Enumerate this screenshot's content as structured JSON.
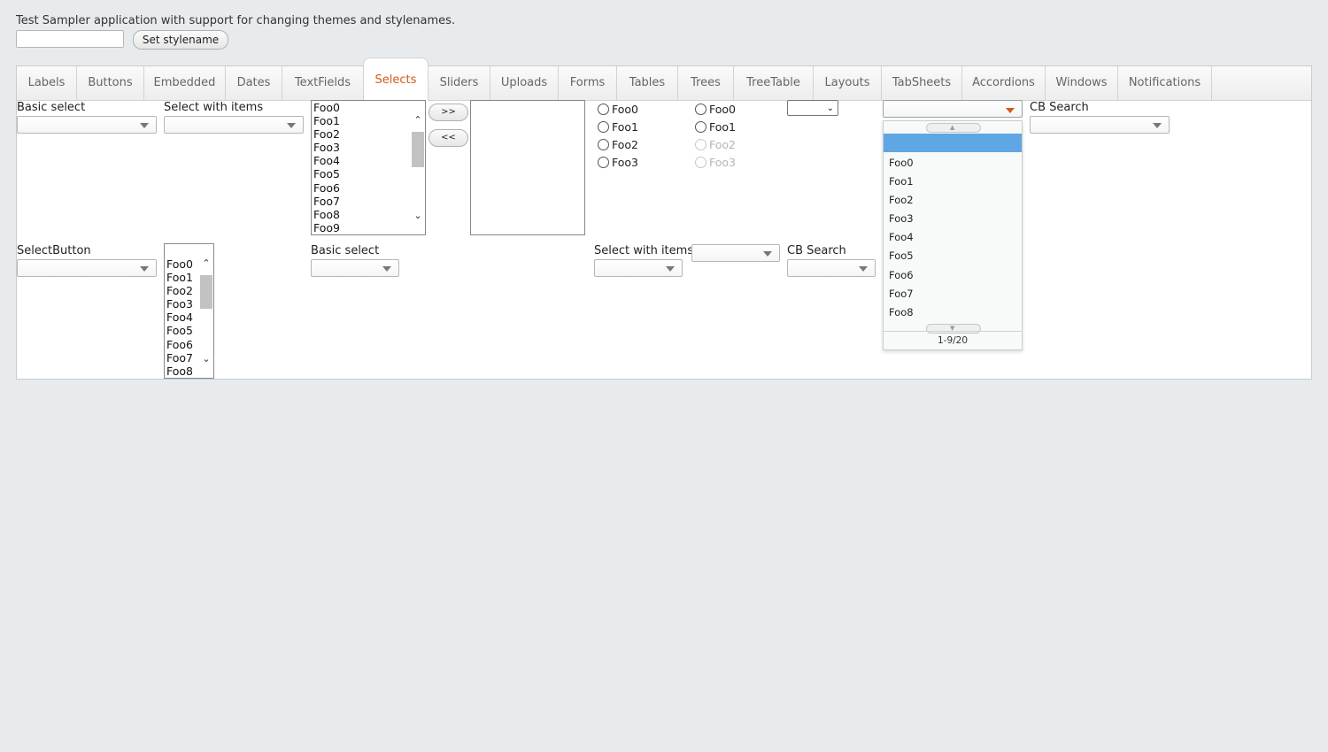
{
  "app": {
    "description": "Test Sampler application with support for changing themes and stylenames.",
    "stylename_input_value": "",
    "set_stylename_label": "Set stylename"
  },
  "tabs": [
    {
      "label": "Labels"
    },
    {
      "label": "Buttons"
    },
    {
      "label": "Embedded"
    },
    {
      "label": "Dates"
    },
    {
      "label": "TextFields"
    },
    {
      "label": "Selects",
      "selected": true
    },
    {
      "label": "Sliders"
    },
    {
      "label": "Uploads"
    },
    {
      "label": "Forms"
    },
    {
      "label": "Tables"
    },
    {
      "label": "Trees"
    },
    {
      "label": "TreeTable"
    },
    {
      "label": "Layouts"
    },
    {
      "label": "TabSheets"
    },
    {
      "label": "Accordions"
    },
    {
      "label": "Windows"
    },
    {
      "label": "Notifications"
    }
  ],
  "row1": {
    "basic_select_caption": "Basic select",
    "select_items_caption": "Select with items",
    "listbox_options": [
      "Foo0",
      "Foo1",
      "Foo2",
      "Foo3",
      "Foo4",
      "Foo5",
      "Foo6",
      "Foo7",
      "Foo8",
      "Foo9"
    ],
    "twincol_add_label": ">>",
    "twincol_remove_label": "<<",
    "radio_group_1": [
      "Foo0",
      "Foo1",
      "Foo2",
      "Foo3"
    ],
    "radio_group_2": [
      "Foo0",
      "Foo1",
      "Foo2",
      "Foo3"
    ],
    "native_select_value": "",
    "combobox_value": "",
    "combobox_popup_options": [
      "Foo0",
      "Foo1",
      "Foo2",
      "Foo3",
      "Foo4",
      "Foo5",
      "Foo6",
      "Foo7",
      "Foo8"
    ],
    "combobox_popup_status": "1-9/20",
    "cb_search_caption": "CB Search"
  },
  "row2": {
    "select_button_caption": "SelectButton",
    "listbox_options": [
      "Foo0",
      "Foo1",
      "Foo2",
      "Foo3",
      "Foo4",
      "Foo5",
      "Foo6",
      "Foo7",
      "Foo8"
    ],
    "basic_select_caption": "Basic select",
    "select_items_caption": "Select with items",
    "cb_search_caption": "CB Search"
  },
  "colors": {
    "accent": "#d35a1b",
    "highlight": "#5ea7e4",
    "background": "#e8ebed"
  }
}
